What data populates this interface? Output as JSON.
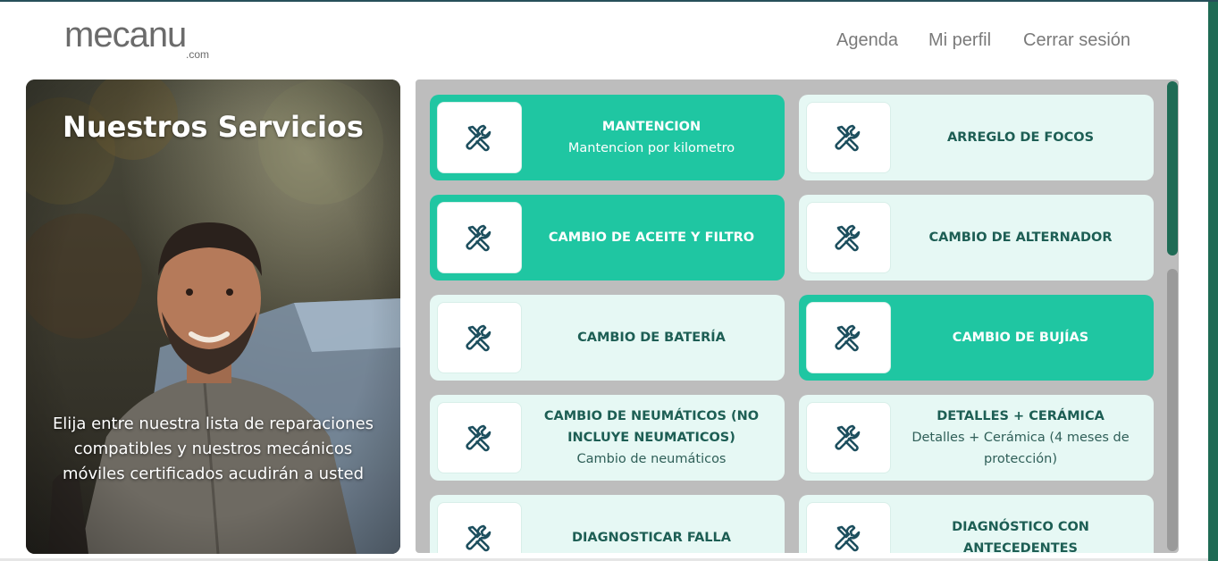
{
  "header": {
    "logo_main": "mecanu",
    "logo_sub": ".com",
    "nav": [
      "Agenda",
      "Mi perfil",
      "Cerrar sesión"
    ]
  },
  "hero": {
    "title": "Nuestros Servicios",
    "description": "Elija entre nuestra lista de reparaciones compatibles y nuestros mecánicos móviles certificados acudirán a usted"
  },
  "services": [
    {
      "title": "MANTENCION",
      "subtitle": "Mantencion por kilometro",
      "selected": true,
      "icon": "wrench-screwdriver-icon"
    },
    {
      "title": "ARREGLO DE FOCOS",
      "subtitle": "",
      "selected": false,
      "icon": "wrench-screwdriver-icon"
    },
    {
      "title": "CAMBIO DE ACEITE Y FILTRO",
      "subtitle": "",
      "selected": true,
      "icon": "wrench-screwdriver-icon"
    },
    {
      "title": "CAMBIO DE ALTERNADOR",
      "subtitle": "",
      "selected": false,
      "icon": "wrench-screwdriver-icon"
    },
    {
      "title": "CAMBIO DE BATERÍA",
      "subtitle": "",
      "selected": false,
      "icon": "wrench-screwdriver-icon"
    },
    {
      "title": "CAMBIO DE BUJÍAS",
      "subtitle": "",
      "selected": true,
      "icon": "wrench-screwdriver-icon"
    },
    {
      "title": "CAMBIO DE NEUMÁTICOS (NO INCLUYE NEUMATICOS)",
      "subtitle": "Cambio de neumáticos",
      "selected": false,
      "icon": "wrench-screwdriver-icon"
    },
    {
      "title": "DETALLES + CERÁMICA",
      "subtitle": "Detalles + Cerámica (4 meses de protección)",
      "selected": false,
      "icon": "wrench-screwdriver-icon"
    },
    {
      "title": "DIAGNOSTICAR FALLA",
      "subtitle": "",
      "selected": false,
      "icon": "wrench-screwdriver-icon"
    },
    {
      "title": "DIAGNÓSTICO CON ANTECEDENTES",
      "subtitle": "",
      "selected": false,
      "icon": "wrench-screwdriver-icon"
    }
  ],
  "colors": {
    "accent": "#1fc6a2",
    "card_bg": "#e6f8f4",
    "text_dark": "#1d5e54",
    "scroll_thumb": "#1f6b55"
  }
}
